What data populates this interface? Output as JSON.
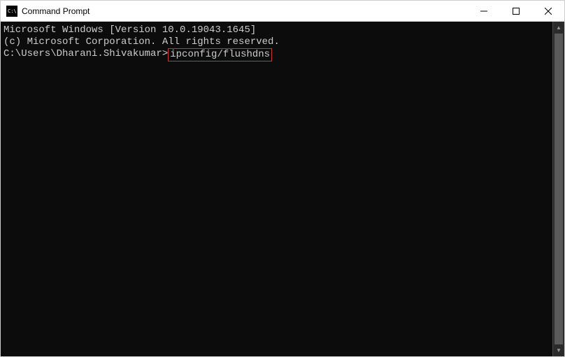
{
  "window": {
    "title": "Command Prompt"
  },
  "terminal": {
    "line1": "Microsoft Windows [Version 10.0.19043.1645]",
    "line2": "(c) Microsoft Corporation. All rights reserved.",
    "blank": "",
    "prompt": "C:\\Users\\Dharani.Shivakumar>",
    "command": "ipconfig/flushdns"
  }
}
